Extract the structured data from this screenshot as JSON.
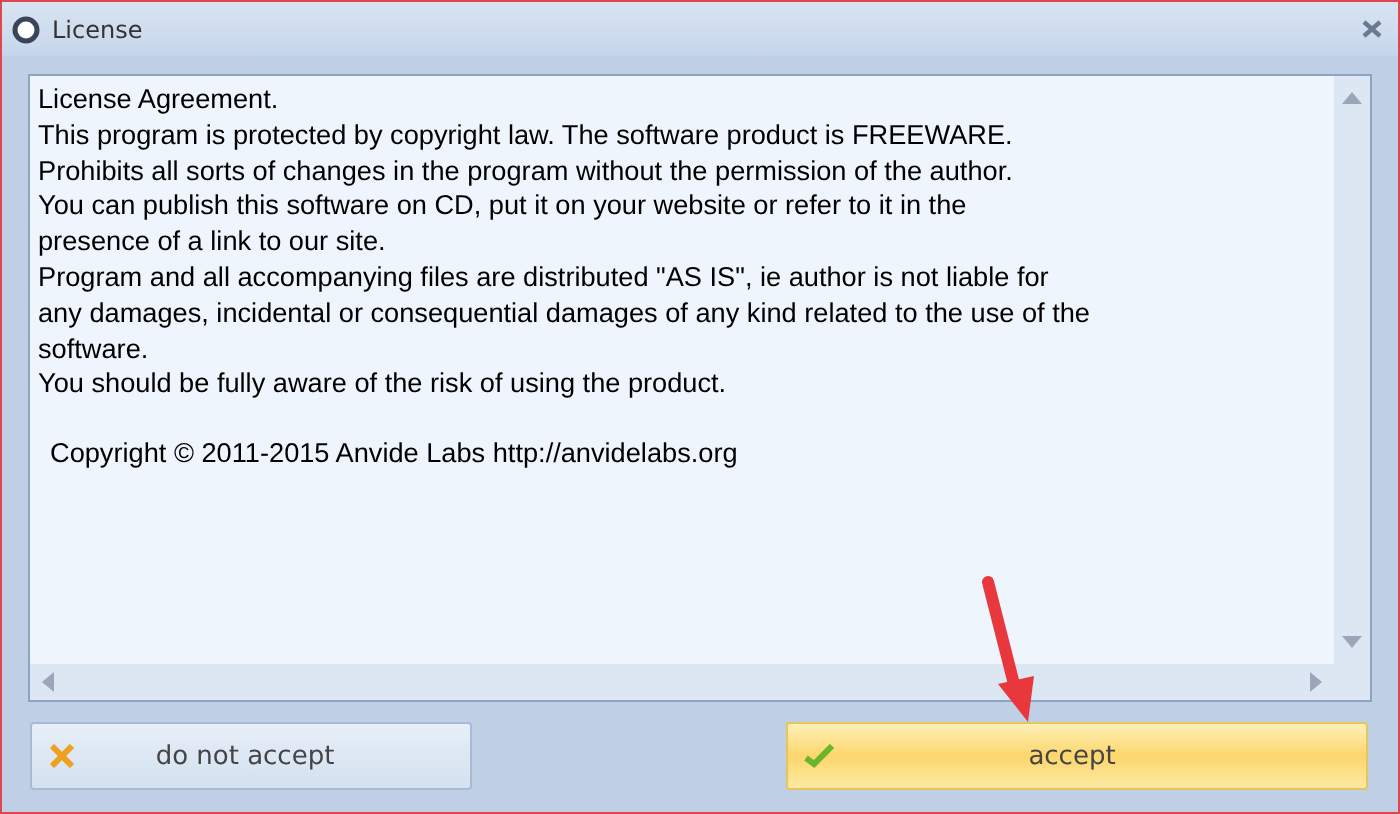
{
  "window": {
    "title": "License"
  },
  "license_text": {
    "lines": [
      "License Agreement.",
      "This program is protected by copyright law. The software product is FREEWARE.",
      "Prohibits all sorts of changes in the program without the permission of the author.",
      "You can publish this software on CD, put it on your website or refer to it in the",
      "presence of a link to our site.",
      "Program and all accompanying files are distributed \"AS IS\", ie author is not liable for",
      "any damages, incidental or consequential damages of any kind related to the use of the",
      "software.",
      "You should be fully aware of the risk of using the product."
    ],
    "copyright": "Copyright © 2011-2015 Anvide Labs http://anvidelabs.org"
  },
  "buttons": [
    {
      "label": "do not accept",
      "kind": "decline",
      "selected": false
    },
    {
      "label": "accept",
      "kind": "accept",
      "selected": true
    }
  ]
}
